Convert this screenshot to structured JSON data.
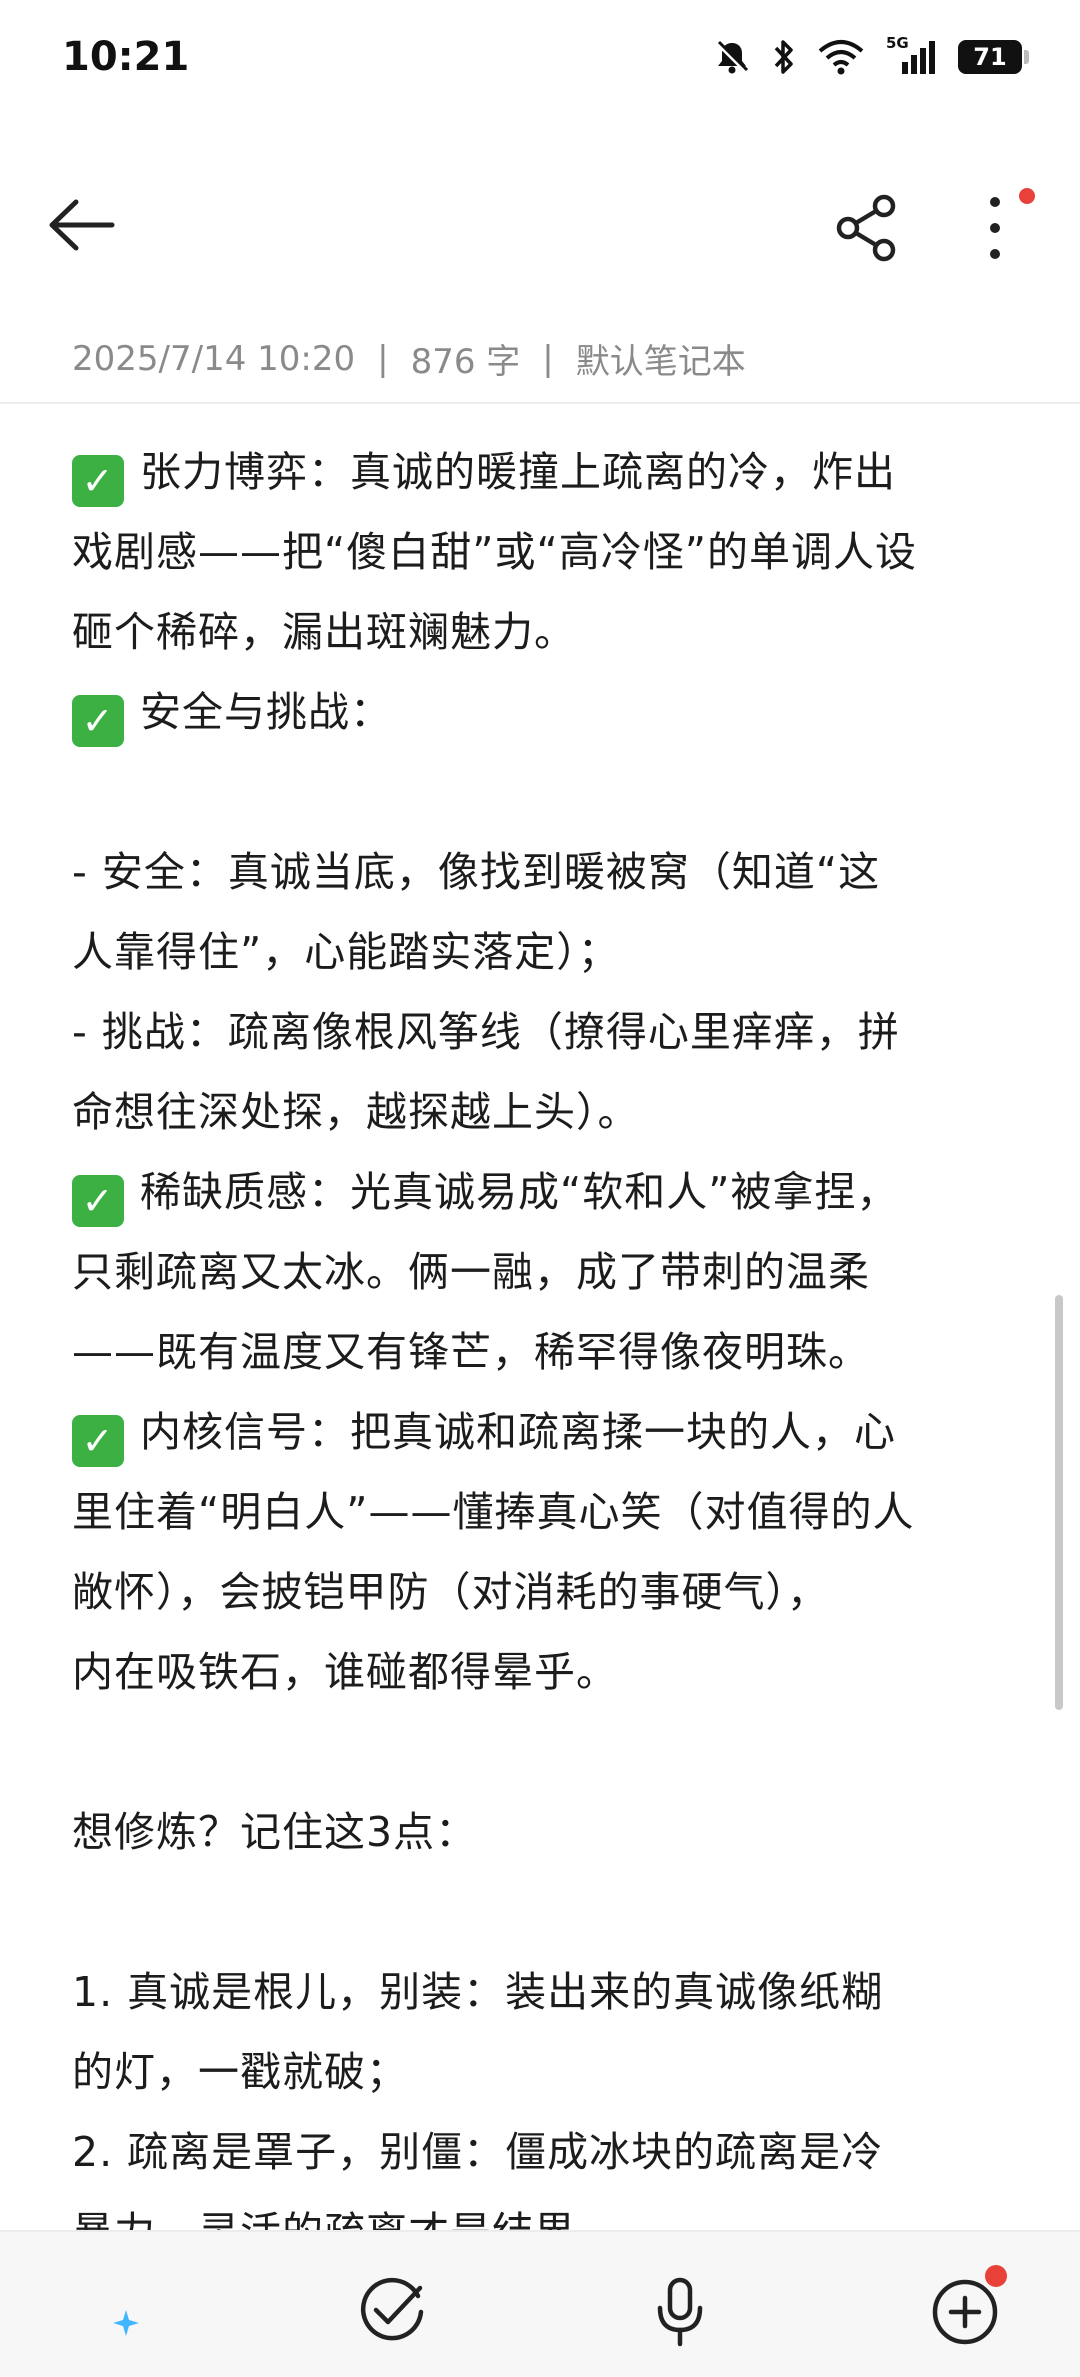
{
  "status_bar": {
    "time": "10:21",
    "battery": "71",
    "network_label": "5G"
  },
  "toolbar": {
    "back_icon": "arrow-left-icon",
    "share_icon": "share-icon",
    "more_icon": "more-vertical-icon"
  },
  "meta": {
    "datetime": "2025/7/14 10:20",
    "word_count": "876 字",
    "notebook": "默认笔记本",
    "separator": "|"
  },
  "content": {
    "lines": [
      {
        "check": true,
        "text": "张力博弈：真诚的暖撞上疏离的冷，炸出"
      },
      {
        "check": false,
        "text": "戏剧感——把“傻白甜”或“高冷怪”的单调人设"
      },
      {
        "check": false,
        "text": "砸个稀碎，漏出斑斓魅力。"
      },
      {
        "check": true,
        "text": "安全与挑战："
      },
      {
        "check": false,
        "text": ""
      },
      {
        "check": false,
        "text": "- 安全：真诚当底，像找到暖被窝（知道“这"
      },
      {
        "check": false,
        "text": "人靠得住”，心能踏实落定）；"
      },
      {
        "check": false,
        "text": "- 挑战：疏离像根风筝线（撩得心里痒痒，拼"
      },
      {
        "check": false,
        "text": "命想往深处探，越探越上头）。"
      },
      {
        "check": true,
        "text": "稀缺质感：光真诚易成“软和人”被拿捏，"
      },
      {
        "check": false,
        "text": "只剩疏离又太冰。俩一融，成了带刺的温柔"
      },
      {
        "check": false,
        "text": "——既有温度又有锋芒，稀罕得像夜明珠。"
      },
      {
        "check": true,
        "text": "内核信号：把真诚和疏离揉一块的人，心"
      },
      {
        "check": false,
        "text": "里住着“明白人”——懂捧真心笑（对值得的人"
      },
      {
        "check": false,
        "text": "敞怀），会披铠甲防（对消耗的事硬气），"
      },
      {
        "check": false,
        "text": "内在吸铁石，谁碰都得晕乎。"
      },
      {
        "check": false,
        "text": ""
      },
      {
        "check": false,
        "text": "想修炼？记住这3点："
      },
      {
        "check": false,
        "text": ""
      },
      {
        "check": false,
        "text": "1. 真诚是根儿，别装：装出来的真诚像纸糊"
      },
      {
        "check": false,
        "text": "的灯，一戳就破；"
      },
      {
        "check": false,
        "text": "2. 疏离是罩子，别僵：僵成冰块的疏离是冷"
      },
      {
        "check": false,
        "text": "暴力，灵活的疏离才是结界。"
      }
    ],
    "check_symbol": "✓"
  },
  "bottom_bar": {
    "items": [
      {
        "icon": "ai-sparkle-list-icon"
      },
      {
        "icon": "checklist-icon"
      },
      {
        "icon": "microphone-icon"
      },
      {
        "icon": "add-circle-icon"
      }
    ]
  },
  "colors": {
    "accent_check": "#3cb043",
    "notification_dot": "#e8413a",
    "meta_text": "#8a8a8a"
  }
}
